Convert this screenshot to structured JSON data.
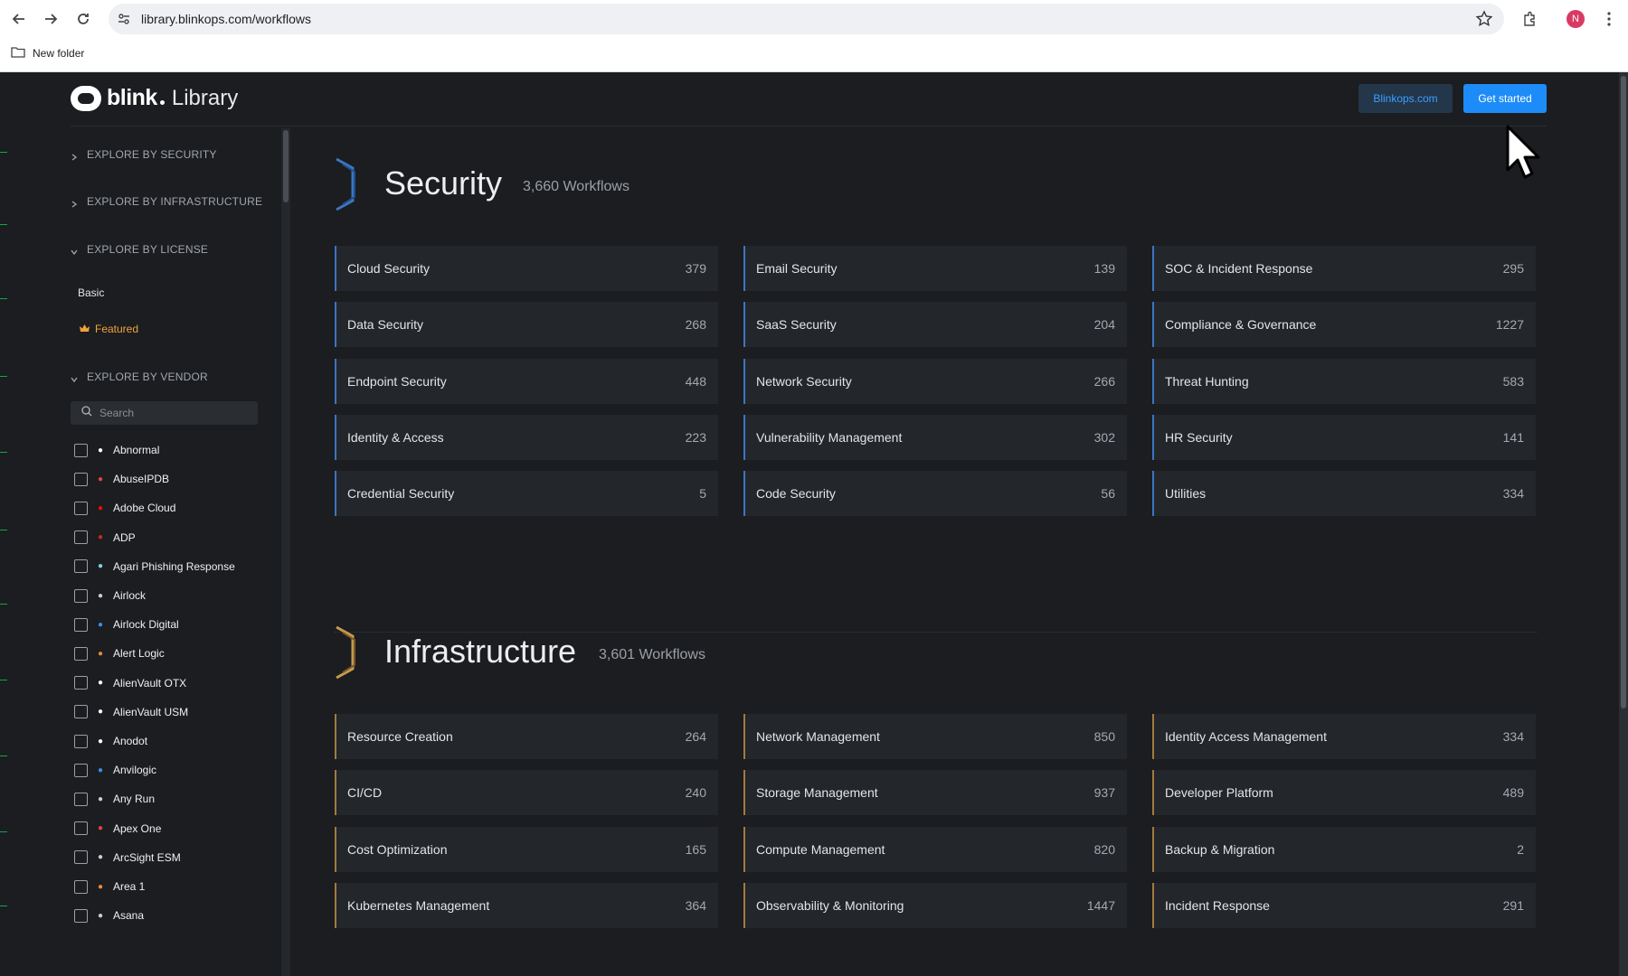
{
  "browser": {
    "url": "library.blinkops.com/workflows",
    "bookmark": "New folder",
    "profile_initial": "N"
  },
  "header": {
    "logo_text": "blink",
    "logo_sub": "Library",
    "site_button": "Blinkops.com",
    "start_button": "Get started"
  },
  "sidebar": {
    "sections": {
      "security": "EXPLORE BY SECURITY",
      "infrastructure": "EXPLORE BY INFRASTRUCTURE",
      "license": "EXPLORE BY LICENSE",
      "vendor": "EXPLORE BY VENDOR"
    },
    "license_items": {
      "basic": "Basic",
      "featured": "Featured"
    },
    "search_placeholder": "Search",
    "vendors": [
      {
        "name": "Abnormal",
        "icon": "abnormal-logo",
        "color": "#ffffff"
      },
      {
        "name": "AbuseIPDB",
        "icon": "abuseipdb-logo",
        "color": "#e0453a"
      },
      {
        "name": "Adobe Cloud",
        "icon": "adobe-logo",
        "color": "#eb1000"
      },
      {
        "name": "ADP",
        "icon": "adp-logo",
        "color": "#d0271d"
      },
      {
        "name": "Agari Phishing Response",
        "icon": "agari-logo",
        "color": "#7fd3e6"
      },
      {
        "name": "Airlock",
        "icon": "airlock-logo",
        "color": "#cfcfcf"
      },
      {
        "name": "Airlock Digital",
        "icon": "airlock-digital-logo",
        "color": "#3a8ee6"
      },
      {
        "name": "Alert Logic",
        "icon": "alert-logic-logo",
        "color": "#e0883a"
      },
      {
        "name": "AlienVault OTX",
        "icon": "alienvault-logo",
        "color": "#ffffff"
      },
      {
        "name": "AlienVault USM",
        "icon": "alienvault-logo",
        "color": "#ffffff"
      },
      {
        "name": "Anodot",
        "icon": "anodot-logo",
        "color": "#ffffff"
      },
      {
        "name": "Anvilogic",
        "icon": "anvilogic-logo",
        "color": "#3a8ee6"
      },
      {
        "name": "Any Run",
        "icon": "anyrun-logo",
        "color": "#cfcfcf"
      },
      {
        "name": "Apex One",
        "icon": "apex-one-logo",
        "color": "#e0453a"
      },
      {
        "name": "ArcSight ESM",
        "icon": "arcsight-logo",
        "color": "#cfcfcf"
      },
      {
        "name": "Area 1",
        "icon": "area1-logo",
        "color": "#f0883a"
      },
      {
        "name": "Asana",
        "icon": "asana-logo",
        "color": "#cfcfcf"
      }
    ]
  },
  "security": {
    "title": "Security",
    "count": "3,660 Workflows",
    "accent": "#3d75c4",
    "items": [
      {
        "label": "Cloud Security",
        "count": "379"
      },
      {
        "label": "Email Security",
        "count": "139"
      },
      {
        "label": "SOC & Incident Response",
        "count": "295"
      },
      {
        "label": "Data Security",
        "count": "268"
      },
      {
        "label": "SaaS Security",
        "count": "204"
      },
      {
        "label": "Compliance & Governance",
        "count": "1227"
      },
      {
        "label": "Endpoint Security",
        "count": "448"
      },
      {
        "label": "Network Security",
        "count": "266"
      },
      {
        "label": "Threat Hunting",
        "count": "583"
      },
      {
        "label": "Identity & Access",
        "count": "223"
      },
      {
        "label": "Vulnerability Management",
        "count": "302"
      },
      {
        "label": "HR Security",
        "count": "141"
      },
      {
        "label": "Credential Security",
        "count": "5"
      },
      {
        "label": "Code Security",
        "count": "56"
      },
      {
        "label": "Utilities",
        "count": "334"
      }
    ]
  },
  "infrastructure": {
    "title": "Infrastructure",
    "count": "3,601 Workflows",
    "accent": "#a47a3e",
    "items": [
      {
        "label": "Resource Creation",
        "count": "264"
      },
      {
        "label": "Network Management",
        "count": "850"
      },
      {
        "label": "Identity Access Management",
        "count": "334"
      },
      {
        "label": "CI/CD",
        "count": "240"
      },
      {
        "label": "Storage Management",
        "count": "937"
      },
      {
        "label": "Developer Platform",
        "count": "489"
      },
      {
        "label": "Cost Optimization",
        "count": "165"
      },
      {
        "label": "Compute Management",
        "count": "820"
      },
      {
        "label": "Backup & Migration",
        "count": "2"
      },
      {
        "label": "Kubernetes Management",
        "count": "364"
      },
      {
        "label": "Observability & Monitoring",
        "count": "1447"
      },
      {
        "label": "Incident Response",
        "count": "291"
      }
    ]
  }
}
